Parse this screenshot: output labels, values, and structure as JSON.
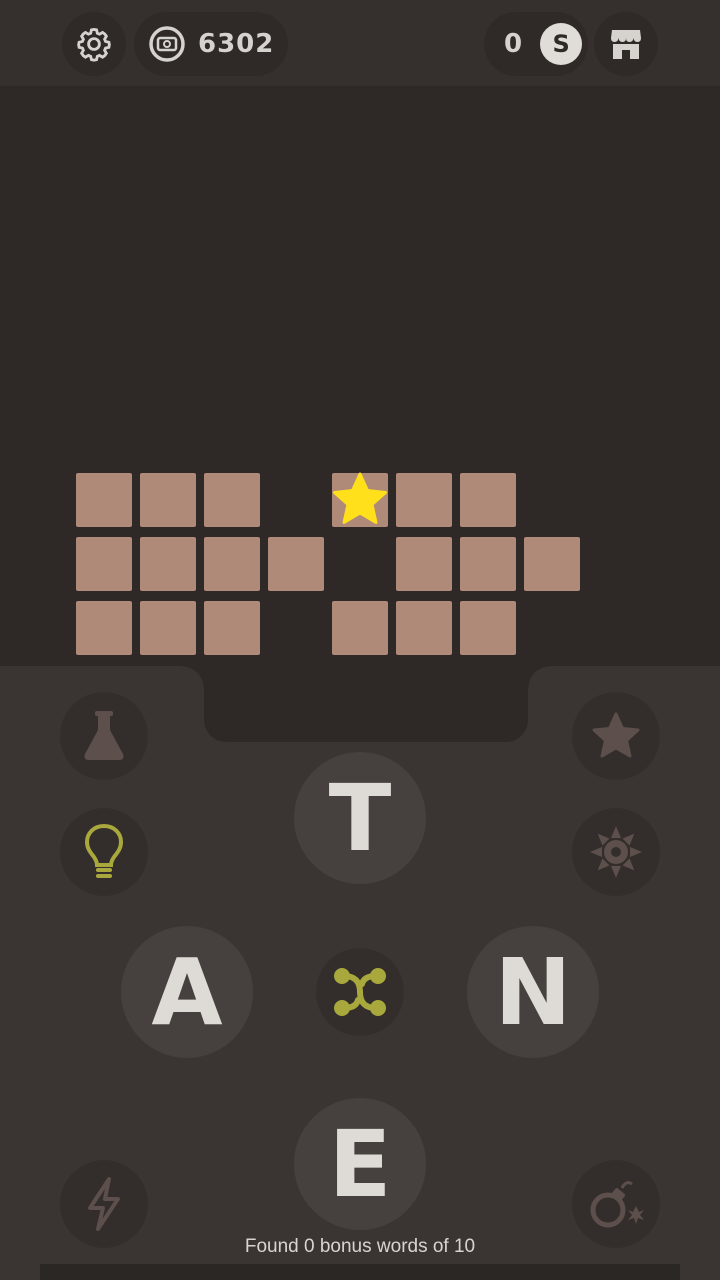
{
  "header": {
    "coins": "6302",
    "score": "0",
    "score_badge": "S"
  },
  "board": {
    "rows": 3,
    "words": 6,
    "star_bonus_cell": "row 1, word 2, letter 1"
  },
  "wheel": {
    "letters": [
      "T",
      "A",
      "N",
      "E"
    ]
  },
  "status": {
    "text": "Found 0 bonus words of 10"
  },
  "colors": {
    "background": "#2e2826",
    "tile": "#b08a78",
    "star": "#ffe01a",
    "hint": "#a9a83d",
    "panel": "#3a3532"
  },
  "icons": {
    "settings": "gear-icon",
    "coins": "coin-icon",
    "shop": "shop-icon",
    "flask": "flask-icon",
    "star": "star-icon",
    "hint": "lightbulb-icon",
    "reveal": "burst-icon",
    "shuffle": "shuffle-icon",
    "lightning": "lightning-icon",
    "bomb": "bomb-icon"
  }
}
